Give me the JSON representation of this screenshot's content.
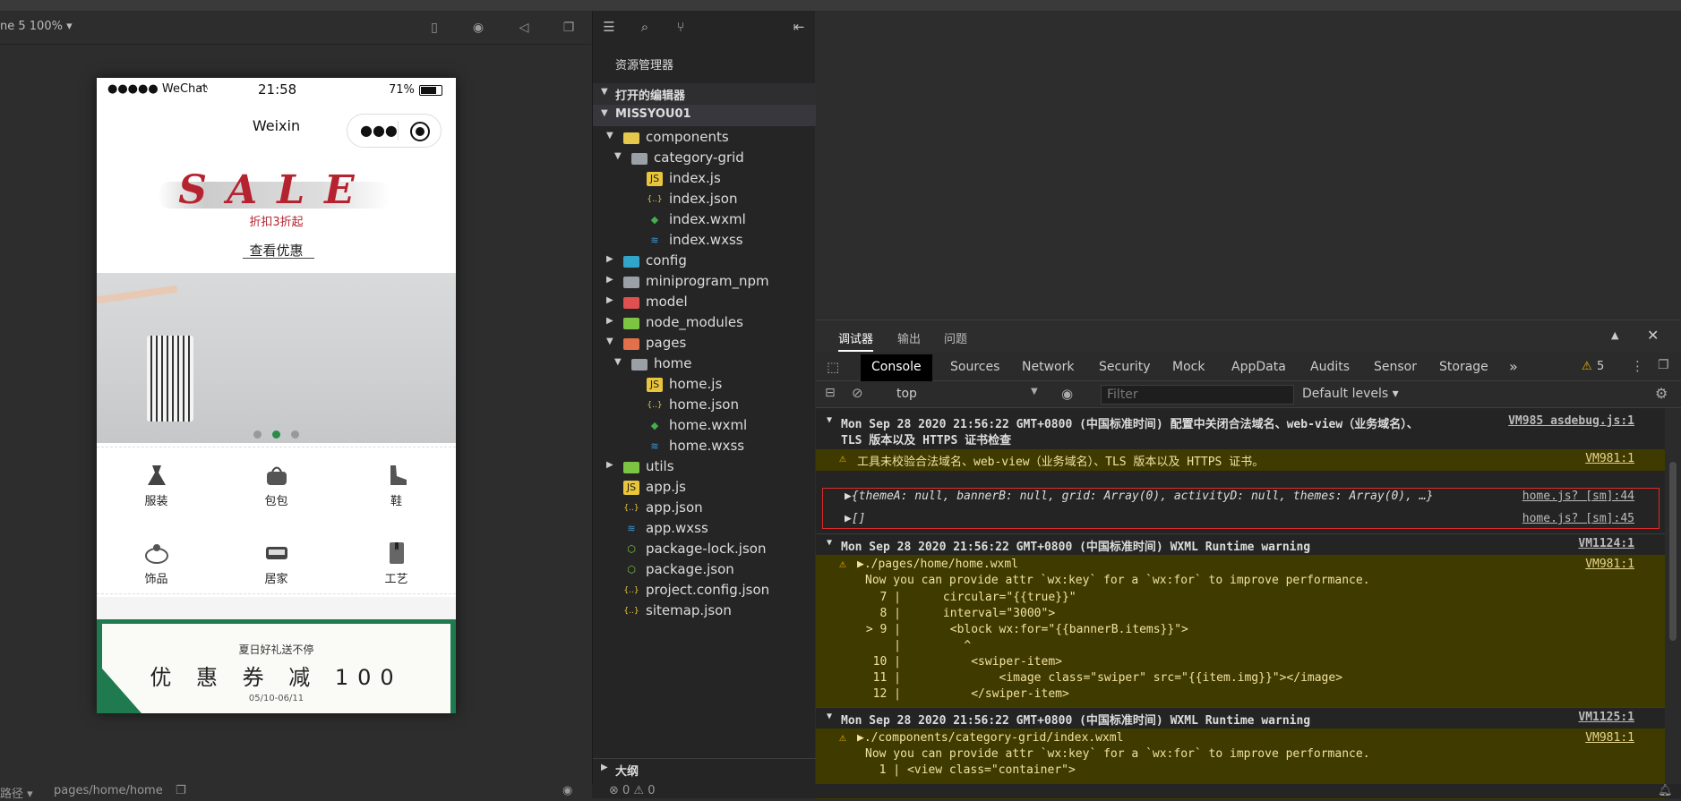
{
  "simulator": {
    "device_label": "ne 5 100% ▾",
    "footer_path_label": "路径 ▾",
    "footer_page": "pages/home/home",
    "phone": {
      "carrier": "●●●●● WeChat",
      "time": "21:58",
      "battery": "71%",
      "nav_title": "Weixin",
      "sale_title": "SALE",
      "sale_sub": "折扣3折起",
      "sale_link": "查看优惠",
      "banner_dots": 3,
      "banner_active": 2,
      "categories": [
        {
          "label": "服装",
          "icon": "dress-icon"
        },
        {
          "label": "包包",
          "icon": "bag-icon"
        },
        {
          "label": "鞋",
          "icon": "shoe-icon"
        },
        {
          "label": "饰品",
          "icon": "ring-icon"
        },
        {
          "label": "居家",
          "icon": "home-goods-icon"
        },
        {
          "label": "工艺",
          "icon": "bookmark-icon"
        }
      ],
      "coupon_top": "夏日好礼送不停",
      "coupon_main": "优 惠 券 减 100",
      "coupon_date": "05/10-06/11"
    }
  },
  "explorer": {
    "title": "资源管理器",
    "open_editors": "打开的编辑器",
    "project": "MISSYOU01",
    "outline": "大纲",
    "tree": [
      {
        "label": "components",
        "kind": "folder",
        "color": "#e6c84a",
        "level": 1,
        "arrow": "▼"
      },
      {
        "label": "category-grid",
        "kind": "folder",
        "color": "#9aa0a6",
        "level": 2,
        "arrow": "▼"
      },
      {
        "label": "index.js",
        "kind": "js",
        "color": "#e8c53a",
        "level": 3,
        "arrow": ""
      },
      {
        "label": "index.json",
        "kind": "json",
        "color": "#e8c53a",
        "level": 3,
        "arrow": ""
      },
      {
        "label": "index.wxml",
        "kind": "wxml",
        "color": "#43b04a",
        "level": 3,
        "arrow": ""
      },
      {
        "label": "index.wxss",
        "kind": "wxss",
        "color": "#3a9ad9",
        "level": 3,
        "arrow": ""
      },
      {
        "label": "config",
        "kind": "folder",
        "color": "#31a5c9",
        "level": 1,
        "arrow": "▶"
      },
      {
        "label": "miniprogram_npm",
        "kind": "folder",
        "color": "#9aa0a6",
        "level": 1,
        "arrow": "▶"
      },
      {
        "label": "model",
        "kind": "folder",
        "color": "#e05050",
        "level": 1,
        "arrow": "▶"
      },
      {
        "label": "node_modules",
        "kind": "folder",
        "color": "#7cc442",
        "level": 1,
        "arrow": "▶"
      },
      {
        "label": "pages",
        "kind": "folder",
        "color": "#e2704a",
        "level": 1,
        "arrow": "▼"
      },
      {
        "label": "home",
        "kind": "folder",
        "color": "#9aa0a6",
        "level": 2,
        "arrow": "▼"
      },
      {
        "label": "home.js",
        "kind": "js",
        "color": "#e8c53a",
        "level": 3,
        "arrow": ""
      },
      {
        "label": "home.json",
        "kind": "json",
        "color": "#e8c53a",
        "level": 3,
        "arrow": ""
      },
      {
        "label": "home.wxml",
        "kind": "wxml",
        "color": "#43b04a",
        "level": 3,
        "arrow": ""
      },
      {
        "label": "home.wxss",
        "kind": "wxss",
        "color": "#3a9ad9",
        "level": 3,
        "arrow": ""
      },
      {
        "label": "utils",
        "kind": "folder",
        "color": "#7cc442",
        "level": 1,
        "arrow": "▶"
      },
      {
        "label": "app.js",
        "kind": "js",
        "color": "#e8c53a",
        "level": 1,
        "arrow": ""
      },
      {
        "label": "app.json",
        "kind": "json",
        "color": "#e8c53a",
        "level": 1,
        "arrow": ""
      },
      {
        "label": "app.wxss",
        "kind": "wxss",
        "color": "#3a9ad9",
        "level": 1,
        "arrow": ""
      },
      {
        "label": "package-lock.json",
        "kind": "npm",
        "color": "#7cc442",
        "level": 1,
        "arrow": ""
      },
      {
        "label": "package.json",
        "kind": "npm",
        "color": "#7cc442",
        "level": 1,
        "arrow": ""
      },
      {
        "label": "project.config.json",
        "kind": "json",
        "color": "#e8c53a",
        "level": 1,
        "arrow": ""
      },
      {
        "label": "sitemap.json",
        "kind": "json",
        "color": "#e8c53a",
        "level": 1,
        "arrow": ""
      }
    ]
  },
  "devtools": {
    "panel_tabs": [
      "调试器",
      "输出",
      "问题"
    ],
    "tool_tabs": [
      "Console",
      "Sources",
      "Network",
      "Security",
      "Mock",
      "AppData",
      "Audits",
      "Sensor",
      "Storage"
    ],
    "more": "»",
    "warn_count": "5",
    "context": "top",
    "filter_placeholder": "Filter",
    "levels": "Default levels ▾",
    "logs": {
      "g1_header_a": "Mon Sep 28 2020 21:56:22 GMT+0800 (中国标准时间) 配置中关闭合法域名、web-view（业务域名）、",
      "g1_header_b": "TLS 版本以及 HTTPS 证书检查",
      "g1_src": "VM985 asdebug.js:1",
      "g1_warn": "工具未校验合法域名、web-view（业务域名）、TLS 版本以及 HTTPS 证书。",
      "g1_warn_src": "VM981:1",
      "obj_line": "▶{themeA: null, bannerB: null, grid: Array(0), activityD: null, themes: Array(0), …}",
      "obj_src": "home.js? [sm]:44",
      "arr_line": "▶[]",
      "arr_src": "home.js? [sm]:45",
      "g2_header": "Mon Sep 28 2020 21:56:22 GMT+0800 (中国标准时间) WXML Runtime warning",
      "g2_src": "VM1124:1",
      "g2_file": "▶./pages/home/home.wxml",
      "g2_file_src": "VM981:1",
      "g2_msg": "Now you can provide attr `wx:key` for a `wx:for` to improve performance.",
      "g2_code": [
        "   7 |      circular=\"{{true}}\"",
        "   8 |      interval=\"3000\">",
        " > 9 |       <block wx:for=\"{{bannerB.items}}\">",
        "     |         ^",
        "  10 |          <swiper-item>",
        "  11 |              <image class=\"swiper\" src=\"{{item.img}}\"></image>",
        "  12 |          </swiper-item>"
      ],
      "g3_header": "Mon Sep 28 2020 21:56:22 GMT+0800 (中国标准时间) WXML Runtime warning",
      "g3_src": "VM1125:1",
      "g3_file": "▶./components/category-grid/index.wxml",
      "g3_file_src": "VM981:1",
      "g3_msg": "Now you can provide attr `wx:key` for a `wx:for` to improve performance.",
      "g3_code": "  1 | <view class=\"container\">"
    },
    "status_errors": "⊗ 0 ⚠ 0"
  }
}
